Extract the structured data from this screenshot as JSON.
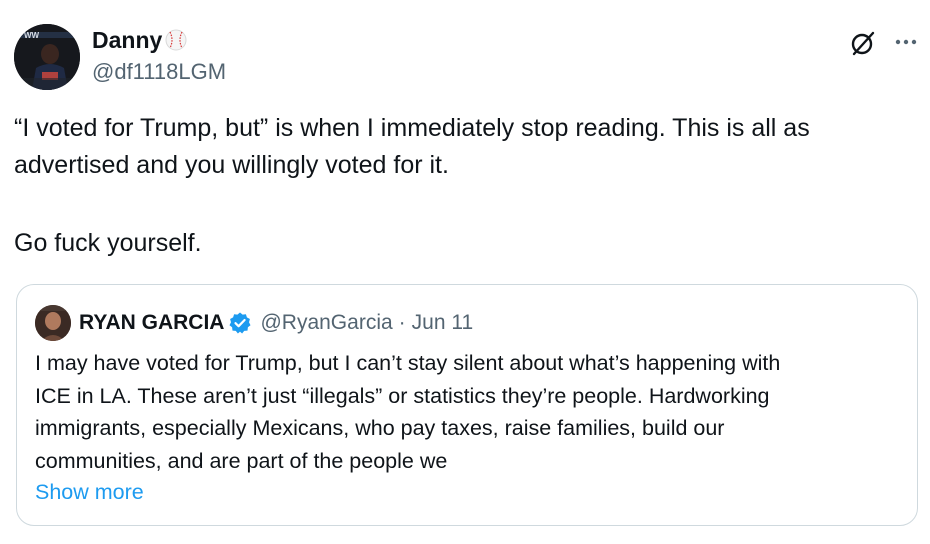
{
  "tweet": {
    "author": {
      "name": "Danny",
      "handle": "@df1118LGM",
      "name_emoji_icon": "baseball-icon"
    },
    "icons": {
      "grok": "grok-icon",
      "more": "more-options-icon"
    },
    "body": {
      "line1": "“I voted for Trump, but” is when I immediately stop reading. This is all as",
      "line2": "advertised and you willingly voted for it.",
      "line3": "Go fuck yourself."
    },
    "quote": {
      "name": "RYAN GARCIA",
      "verified": true,
      "handle": "@RyanGarcia",
      "separator": "·",
      "date": "Jun 11",
      "text_lines": [
        "I may have voted for Trump, but I can’t stay silent about what’s happening with",
        "ICE in LA. These aren’t just “illegals” or statistics they’re people. Hardworking",
        "immigrants, especially Mexicans, who pay taxes, raise families, build our",
        "communities, and are part of the people we"
      ],
      "show_more": "Show more"
    },
    "colors": {
      "text": "#0f1419",
      "secondary": "#536471",
      "link": "#1d9bf0",
      "border": "#cfd9de",
      "verified": "#1d9bf0"
    }
  }
}
